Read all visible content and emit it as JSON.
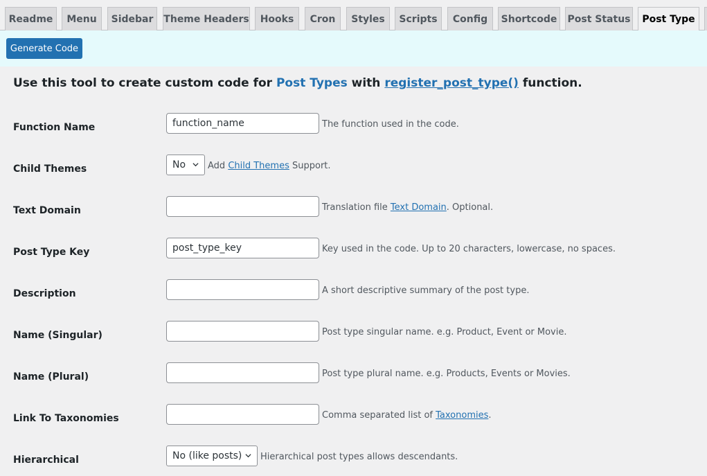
{
  "tabs": [
    {
      "label": "Readme"
    },
    {
      "label": "Menu"
    },
    {
      "label": "Sidebar"
    },
    {
      "label": "Theme Headers"
    },
    {
      "label": "Hooks"
    },
    {
      "label": "Cron"
    },
    {
      "label": "Styles"
    },
    {
      "label": "Scripts"
    },
    {
      "label": "Config"
    },
    {
      "label": "Shortcode"
    },
    {
      "label": "Post Status"
    },
    {
      "label": "Post Type"
    }
  ],
  "active_tab": "Post Type",
  "toolbar": {
    "generate_label": "Generate Code"
  },
  "intro": {
    "prefix": "Use this tool to create custom code for ",
    "link1": "Post Types",
    "middle": " with ",
    "link2": "register_post_type()",
    "suffix": " function."
  },
  "form": {
    "function_name": {
      "label": "Function Name",
      "value": "function_name",
      "desc": "The function used in the code."
    },
    "child_themes": {
      "label": "Child Themes",
      "value": "No",
      "desc_pre": "Add ",
      "desc_link": "Child Themes",
      "desc_post": " Support."
    },
    "text_domain": {
      "label": "Text Domain",
      "value": "",
      "desc_pre": "Translation file ",
      "desc_link": "Text Domain",
      "desc_post": ". Optional."
    },
    "post_type_key": {
      "label": "Post Type Key",
      "value": "post_type_key",
      "desc": "Key used in the code. Up to 20 characters, lowercase, no spaces."
    },
    "description": {
      "label": "Description",
      "value": "",
      "desc": "A short descriptive summary of the post type."
    },
    "name_singular": {
      "label": "Name (Singular)",
      "value": "",
      "desc": "Post type singular name. e.g. Product, Event or Movie."
    },
    "name_plural": {
      "label": "Name (Plural)",
      "value": "",
      "desc": "Post type plural name. e.g. Products, Events or Movies."
    },
    "taxonomies": {
      "label": "Link To Taxonomies",
      "value": "",
      "desc_pre": "Comma separated list of ",
      "desc_link": "Taxonomies",
      "desc_post": "."
    },
    "hierarchical": {
      "label": "Hierarchical",
      "value": "No (like posts)",
      "desc": "Hierarchical post types allows descendants."
    }
  }
}
